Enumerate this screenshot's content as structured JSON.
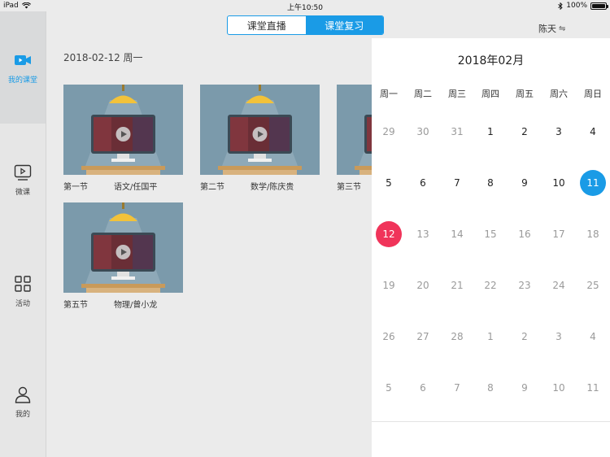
{
  "status_bar": {
    "device": "iPad",
    "time": "上午10:50",
    "battery": "100%",
    "battery_level": 1.0
  },
  "top_tabs": [
    {
      "label": "课堂直播",
      "active": false
    },
    {
      "label": "课堂复习",
      "active": true
    }
  ],
  "user": {
    "name": "陈天",
    "swap_icon": "⇋"
  },
  "sidebar": {
    "items": [
      {
        "label": "我的课堂",
        "icon": "video-camera-icon",
        "active": true
      },
      {
        "label": "微课",
        "icon": "play-screen-icon",
        "active": false
      },
      {
        "label": "活动",
        "icon": "grid-icon",
        "active": false
      },
      {
        "label": "我的",
        "icon": "person-icon",
        "active": false
      }
    ]
  },
  "main": {
    "date_heading": "2018-02-12 周一",
    "lessons": [
      {
        "period": "第一节",
        "subject": "语文/任国平"
      },
      {
        "period": "第二节",
        "subject": "数学/陈庆贵"
      },
      {
        "period": "第三节",
        "subject": ""
      },
      {
        "period": "第五节",
        "subject": "物理/曾小龙"
      }
    ]
  },
  "calendar": {
    "month_title": "2018年02月",
    "weekdays": [
      "周一",
      "周二",
      "周三",
      "周四",
      "周五",
      "周六",
      "周日"
    ],
    "weeks": [
      [
        {
          "d": "29",
          "c": "other"
        },
        {
          "d": "30",
          "c": "other"
        },
        {
          "d": "31",
          "c": "other"
        },
        {
          "d": "1",
          "c": "cur"
        },
        {
          "d": "2",
          "c": "cur"
        },
        {
          "d": "3",
          "c": "cur"
        },
        {
          "d": "4",
          "c": "cur"
        }
      ],
      [
        {
          "d": "5",
          "c": "cur"
        },
        {
          "d": "6",
          "c": "cur"
        },
        {
          "d": "7",
          "c": "cur"
        },
        {
          "d": "8",
          "c": "cur"
        },
        {
          "d": "9",
          "c": "cur"
        },
        {
          "d": "10",
          "c": "cur"
        },
        {
          "d": "11",
          "c": "selected"
        }
      ],
      [
        {
          "d": "12",
          "c": "today"
        },
        {
          "d": "13",
          "c": "other"
        },
        {
          "d": "14",
          "c": "other"
        },
        {
          "d": "15",
          "c": "other"
        },
        {
          "d": "16",
          "c": "other"
        },
        {
          "d": "17",
          "c": "other"
        },
        {
          "d": "18",
          "c": "other"
        }
      ],
      [
        {
          "d": "19",
          "c": "other"
        },
        {
          "d": "20",
          "c": "other"
        },
        {
          "d": "21",
          "c": "other"
        },
        {
          "d": "22",
          "c": "other"
        },
        {
          "d": "23",
          "c": "other"
        },
        {
          "d": "24",
          "c": "other"
        },
        {
          "d": "25",
          "c": "other"
        }
      ],
      [
        {
          "d": "26",
          "c": "other"
        },
        {
          "d": "27",
          "c": "other"
        },
        {
          "d": "28",
          "c": "other"
        },
        {
          "d": "1",
          "c": "other"
        },
        {
          "d": "2",
          "c": "other"
        },
        {
          "d": "3",
          "c": "other"
        },
        {
          "d": "4",
          "c": "other"
        }
      ],
      [
        {
          "d": "5",
          "c": "other"
        },
        {
          "d": "6",
          "c": "other"
        },
        {
          "d": "7",
          "c": "other"
        },
        {
          "d": "8",
          "c": "other"
        },
        {
          "d": "9",
          "c": "other"
        },
        {
          "d": "10",
          "c": "other"
        },
        {
          "d": "11",
          "c": "other"
        }
      ]
    ]
  },
  "colors": {
    "accent": "#1a9be6",
    "today": "#f0345a",
    "thumb_bg": "#7b9aab"
  }
}
